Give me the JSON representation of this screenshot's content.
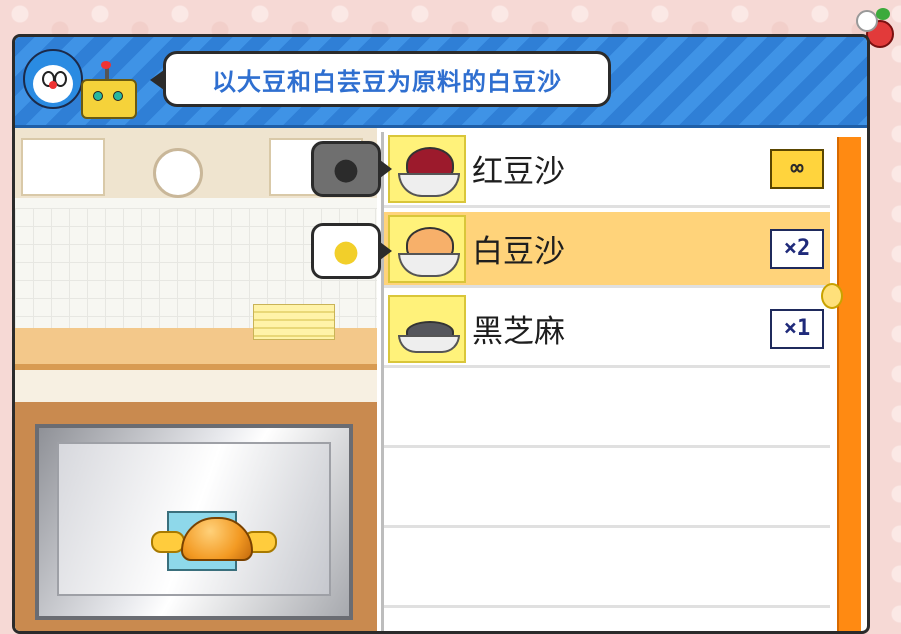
{
  "header": {
    "bubble_text": "以大豆和白芸豆为原料的白豆沙"
  },
  "recipe_list": {
    "items": [
      {
        "name": "红豆沙",
        "qty": "∞",
        "filling_color": "#9c1a2c",
        "selected": false
      },
      {
        "name": "白豆沙",
        "qty": "×2",
        "filling_color": "#f7b06a",
        "selected": true
      },
      {
        "name": "黑芝麻",
        "qty": "×1",
        "filling_color": "#55565c",
        "selected": false
      }
    ],
    "empty_rows": 3
  },
  "hints": [
    {
      "state": "off",
      "icon": "lightbulb-icon"
    },
    {
      "state": "on",
      "icon": "lightbulb-icon"
    }
  ],
  "colors": {
    "header_blue": "#2f7fd6",
    "selected_row": "#ffd37a",
    "scrollbar": "#ff8a12",
    "bubble_text": "#2f6fd0"
  }
}
